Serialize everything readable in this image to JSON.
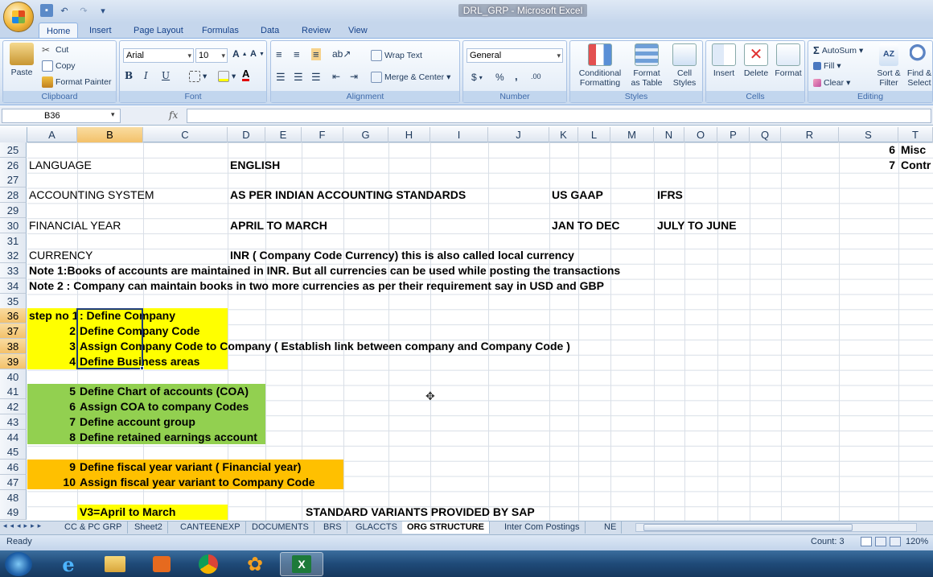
{
  "window": {
    "title": "DRL_GRP - Microsoft Excel"
  },
  "ribbon_tabs": [
    "Home",
    "Insert",
    "Page Layout",
    "Formulas",
    "Data",
    "Review",
    "View"
  ],
  "clipboard": {
    "paste": "Paste",
    "cut": "Cut",
    "copy": "Copy",
    "format_painter": "Format Painter",
    "label": "Clipboard"
  },
  "font": {
    "name": "Arial",
    "size": "10",
    "bold": "B",
    "italic": "I",
    "underline": "U",
    "label": "Font"
  },
  "alignment": {
    "wrap_text": "Wrap Text",
    "merge_center": "Merge & Center",
    "label": "Alignment"
  },
  "number": {
    "format": "General",
    "currency": "$",
    "percent": "%",
    "comma": ",",
    "inc_dec": ".00",
    "label": "Number"
  },
  "styles": {
    "conditional": "Conditional",
    "conditional2": "Formatting",
    "format_as": "Format",
    "format_as2": "as Table",
    "cell": "Cell",
    "cell2": "Styles",
    "label": "Styles"
  },
  "cells": {
    "insert": "Insert",
    "delete": "Delete",
    "format": "Format",
    "label": "Cells"
  },
  "editing": {
    "autosum": "AutoSum",
    "fill": "Fill",
    "clear": "Clear",
    "sort": "Sort &",
    "sort2": "Filter",
    "find": "Find &",
    "find2": "Select",
    "label": "Editing"
  },
  "formula_bar": {
    "name_box": "B36",
    "fx": "fx",
    "formula": ""
  },
  "columns": [
    "A",
    "B",
    "C",
    "D",
    "E",
    "F",
    "G",
    "H",
    "I",
    "J",
    "K",
    "L",
    "M",
    "N",
    "O",
    "P",
    "Q",
    "R",
    "S",
    "T"
  ],
  "rows": [
    "25",
    "26",
    "27",
    "28",
    "29",
    "30",
    "31",
    "32",
    "33",
    "34",
    "35",
    "36",
    "37",
    "38",
    "39",
    "40",
    "41",
    "42",
    "43",
    "44",
    "45",
    "46",
    "47",
    "48",
    "49"
  ],
  "cells_text": {
    "s25": "6",
    "t25": "Misc",
    "a26": "LANGUAGE",
    "d26": "ENGLISH",
    "s26": "7",
    "t26": "Contr",
    "a28": "ACCOUNTING SYSTEM",
    "d28": "AS PER INDIAN ACCOUNTING STANDARDS",
    "k28": "US GAAP",
    "n28": "IFRS",
    "a30": "FINANCIAL YEAR",
    "d30": "APRIL TO MARCH",
    "k30": "JAN TO DEC",
    "n30": "JULY TO JUNE",
    "a32": "CURRENCY",
    "d32": "INR  ( Company Code Currency)  this is also called local currency",
    "a33": "Note 1:Books of accounts are maintained in INR.  But all currencies can be used while posting the transactions",
    "a34": "Note 2 : Company can maintain books in two more currencies as per their requirement  say in USD and GBP",
    "a36": "step no 1",
    "b36": ": Define Company",
    "a37": "2",
    "b37": "Define Company Code",
    "a38": "3",
    "b38": "Assign Company Code to Company ( Establish link between company and Company Code )",
    "a39": "4",
    "b39": "Define Business areas",
    "a41": "5",
    "b41": "Define Chart of accounts  (COA)",
    "a42": "6",
    "b42": "Assign COA to company Codes",
    "a43": "7",
    "b43": "Define account group",
    "a44": "8",
    "b44": "Define retained earnings account",
    "a46": "9",
    "b46": "Define fiscal year variant ( Financial year)",
    "a47": "10",
    "b47": "Assign fiscal year variant to Company Code",
    "b49": "V3=April to March",
    "f49": "STANDARD VARIANTS PROVIDED BY SAP"
  },
  "sheet_tabs": [
    "CC & PC GRP",
    "Sheet2",
    "CANTEENEXP",
    "DOCUMENTS",
    "BRS",
    "GLACCTS",
    "ORG STRUCTURE",
    "Inter Com Postings",
    "NE"
  ],
  "active_sheet": "ORG STRUCTURE",
  "status": {
    "ready": "Ready",
    "count": "Count: 3",
    "zoom": "120%"
  },
  "colors": {
    "yellow": "#ffff00",
    "green": "#92d050",
    "orange": "#ffc000"
  }
}
